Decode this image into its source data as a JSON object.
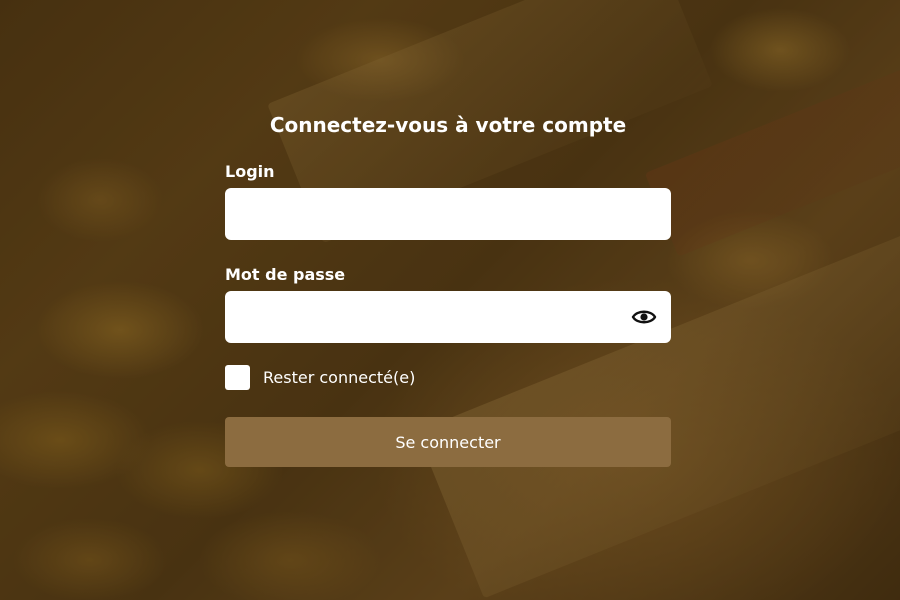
{
  "login_page": {
    "title": "Connectez-vous à votre compte",
    "login": {
      "label": "Login",
      "value": "",
      "placeholder": ""
    },
    "password": {
      "label": "Mot de passe",
      "value": "",
      "placeholder": "",
      "toggle_icon": "eye-icon"
    },
    "remember": {
      "label": "Rester connecté(e)",
      "checked": false
    },
    "submit_label": "Se connecter"
  },
  "colors": {
    "button": "#8c6c40",
    "text": "#ffffff",
    "input_bg": "#ffffff"
  }
}
